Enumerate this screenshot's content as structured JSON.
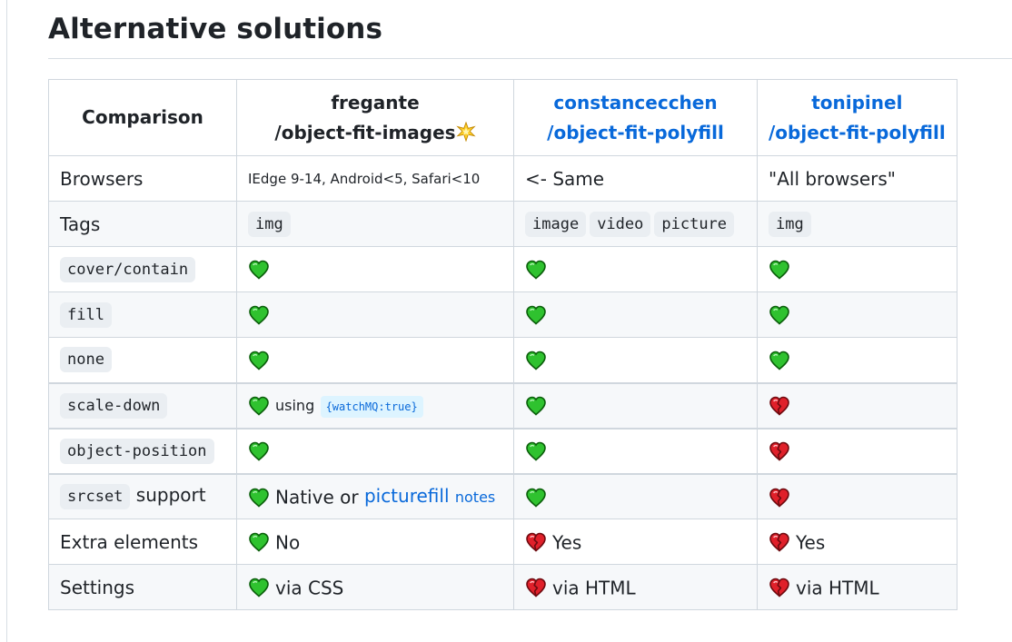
{
  "section": {
    "heading": "Alternative solutions"
  },
  "table": {
    "headers": {
      "comparison": "Comparison",
      "col1_line1": "fregante",
      "col1_line2": "/object-fit-images",
      "col2_line1": "constancecchen",
      "col2_line2": "/object-fit-polyfill",
      "col3_line1": "tonipinel",
      "col3_line2": "/object-fit-polyfill"
    },
    "rows": {
      "browsers": {
        "label": "Browsers",
        "c1": "IEdge 9-14, Android<5, Safari<10",
        "c2": "<- Same",
        "c3": "\"All browsers\""
      },
      "tags": {
        "label": "Tags",
        "c1": [
          "img"
        ],
        "c2": [
          "image",
          "video",
          "picture"
        ],
        "c3": [
          "img"
        ]
      },
      "cover": {
        "label_code": "cover/contain"
      },
      "fill": {
        "label_code": "fill"
      },
      "none": {
        "label_code": "none"
      },
      "scale_down": {
        "label_code": "scale-down",
        "c1_text": "using",
        "c1_code": "{watchMQ:true}"
      },
      "object_position": {
        "label_code": "object-position"
      },
      "srcset": {
        "label_code": "srcset",
        "label_text": "support",
        "c1_text": "Native or",
        "c1_link": "picturefill",
        "c1_notes": "notes"
      },
      "extra": {
        "label": "Extra elements",
        "c1": "No",
        "c2": "Yes",
        "c3": "Yes"
      },
      "settings": {
        "label": "Settings",
        "c1": "via CSS",
        "c2": "via HTML",
        "c3": "via HTML"
      }
    }
  },
  "icons": {
    "supported": "green-heart-icon",
    "unsupported": "broken-heart-icon",
    "star": "sparkle-star-icon"
  },
  "colors": {
    "link": "#0969da",
    "green_heart": "#2fc22f",
    "red_heart": "#e0202a",
    "border": "#d0d7de",
    "alt_row": "#f6f8fa"
  }
}
